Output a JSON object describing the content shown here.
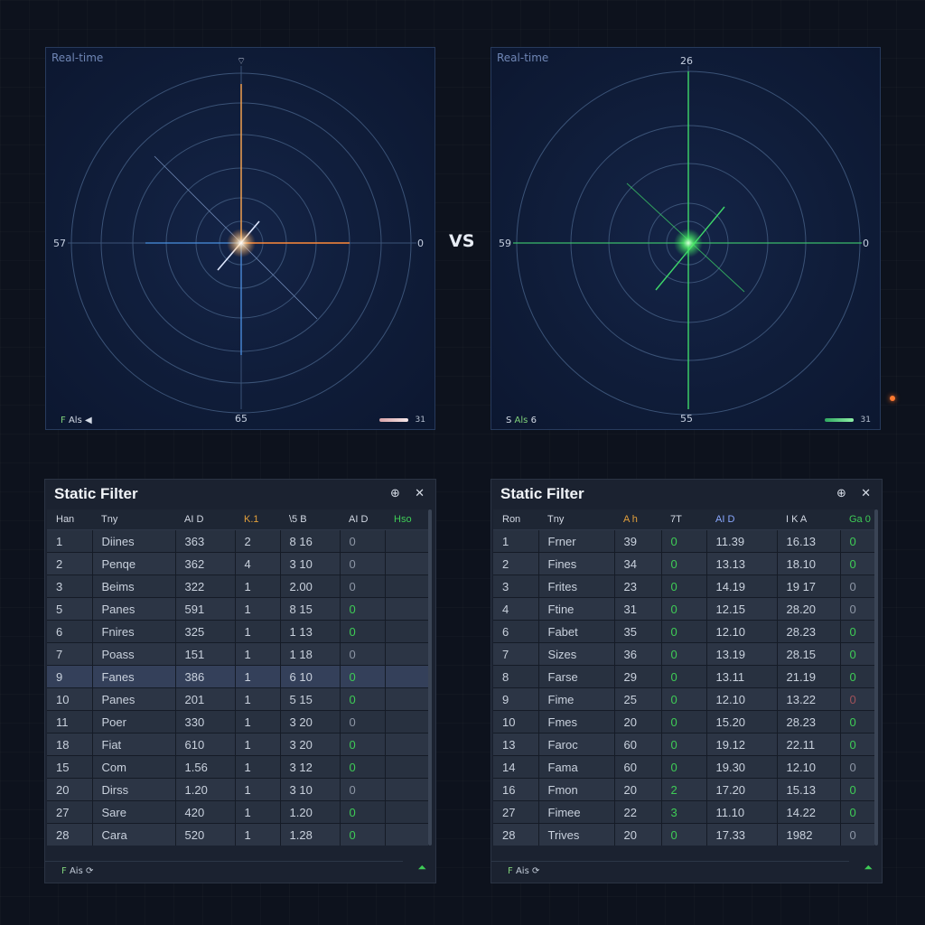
{
  "radar_left": {
    "tag": "Real-time",
    "label_top": "⌔",
    "label_left": "57",
    "label_right": "0",
    "label_bottom": "65",
    "footer_mark": "F",
    "footer_text": "Als",
    "footer_icon": "◀",
    "footer_value": "31",
    "colors": {
      "ring": "#3b5377",
      "beam_vertical": "#f0a050",
      "beam_horizontal": "#ff8a3a",
      "beam_left": "#4a90e0",
      "glow": "#ffffff"
    }
  },
  "radar_right": {
    "tag": "Real-time",
    "label_top": "26",
    "label_left": "59",
    "label_right": "0",
    "label_bottom": "55",
    "footer_mark": "S",
    "footer_text": "Als",
    "footer_icon": "6",
    "footer_value": "31",
    "colors": {
      "ring": "#3b5377",
      "beam": "#3ed86a",
      "glow": "#7dff8a"
    }
  },
  "vs_label": "VS",
  "filter_left": {
    "title": "Static Filter",
    "icon_settings": "⊕",
    "icon_close": "✕",
    "columns": [
      "Han",
      "Tny",
      "AI D",
      "K.1",
      "\\5 B",
      "AI D",
      "Hso"
    ],
    "rows": [
      [
        "1",
        "Diines",
        "363",
        "2",
        "8 16",
        "0",
        ""
      ],
      [
        "2",
        "Penqe",
        "362",
        "4",
        "3 10",
        "0",
        ""
      ],
      [
        "3",
        "Beims",
        "322",
        "1",
        "2.00",
        "0",
        ""
      ],
      [
        "5",
        "Panes",
        "591",
        "1",
        "8 15",
        "0",
        ""
      ],
      [
        "6",
        "Fnires",
        "325",
        "1",
        "1 13",
        "0",
        ""
      ],
      [
        "7",
        "Poass",
        "151",
        "1",
        "1 18",
        "0",
        ""
      ],
      [
        "9",
        "Fanes",
        "386",
        "1",
        "6 10",
        "0",
        ""
      ],
      [
        "10",
        "Panes",
        "201",
        "1",
        "5 15",
        "0",
        ""
      ],
      [
        "11",
        "Poer",
        "330",
        "1",
        "3 20",
        "0",
        ""
      ],
      [
        "18",
        "Fiat",
        "610",
        "1",
        "3 20",
        "0",
        ""
      ],
      [
        "15",
        "Com",
        "1.56",
        "1",
        "3 12",
        "0",
        ""
      ],
      [
        "20",
        "Dirss",
        "1.20",
        "1",
        "3 10",
        "0",
        ""
      ],
      [
        "27",
        "Sare",
        "420",
        "1",
        "1.20",
        "0",
        ""
      ],
      [
        "28",
        "Cara",
        "520",
        "1",
        "1.28",
        "0",
        ""
      ]
    ],
    "footer_mark": "F",
    "footer_text": "Ais",
    "footer_icon": "⟳",
    "footer_right": "⏶"
  },
  "filter_right": {
    "title": "Static Filter",
    "icon_settings": "⊕",
    "icon_close": "✕",
    "columns": [
      "Ron",
      "Tny",
      "A h",
      "7T",
      "AI D",
      "I K A",
      "Ga 0"
    ],
    "rows": [
      [
        "1",
        "Frner",
        "39",
        "0",
        "11.39",
        "16.13",
        "0"
      ],
      [
        "2",
        "Fines",
        "34",
        "0",
        "13.13",
        "18.10",
        "0"
      ],
      [
        "3",
        "Frites",
        "23",
        "0",
        "14.19",
        "19 17",
        "0"
      ],
      [
        "4",
        "Ftine",
        "31",
        "0",
        "12.15",
        "28.20",
        "0"
      ],
      [
        "6",
        "Fabet",
        "35",
        "0",
        "12.10",
        "28.23",
        "0"
      ],
      [
        "7",
        "Sizes",
        "36",
        "0",
        "13.19",
        "28.15",
        "0"
      ],
      [
        "8",
        "Farse",
        "29",
        "0",
        "13.11",
        "21.19",
        "0"
      ],
      [
        "9",
        "Fime",
        "25",
        "0",
        "12.10",
        "13.22",
        "0"
      ],
      [
        "10",
        "Fmes",
        "20",
        "0",
        "15.20",
        "28.23",
        "0"
      ],
      [
        "13",
        "Faroc",
        "60",
        "0",
        "19.12",
        "22.11",
        "0"
      ],
      [
        "14",
        "Fama",
        "60",
        "0",
        "19.30",
        "12.10",
        "0"
      ],
      [
        "16",
        "Fmon",
        "20",
        "2",
        "17.20",
        "15.13",
        "0"
      ],
      [
        "27",
        "Fimee",
        "22",
        "3",
        "11.10",
        "14.22",
        "0"
      ],
      [
        "28",
        "Trives",
        "20",
        "0",
        "17.33",
        "1982",
        "0"
      ]
    ],
    "footer_mark": "F",
    "footer_text": "Ais",
    "footer_icon": "⟳",
    "footer_right": "⏶"
  }
}
